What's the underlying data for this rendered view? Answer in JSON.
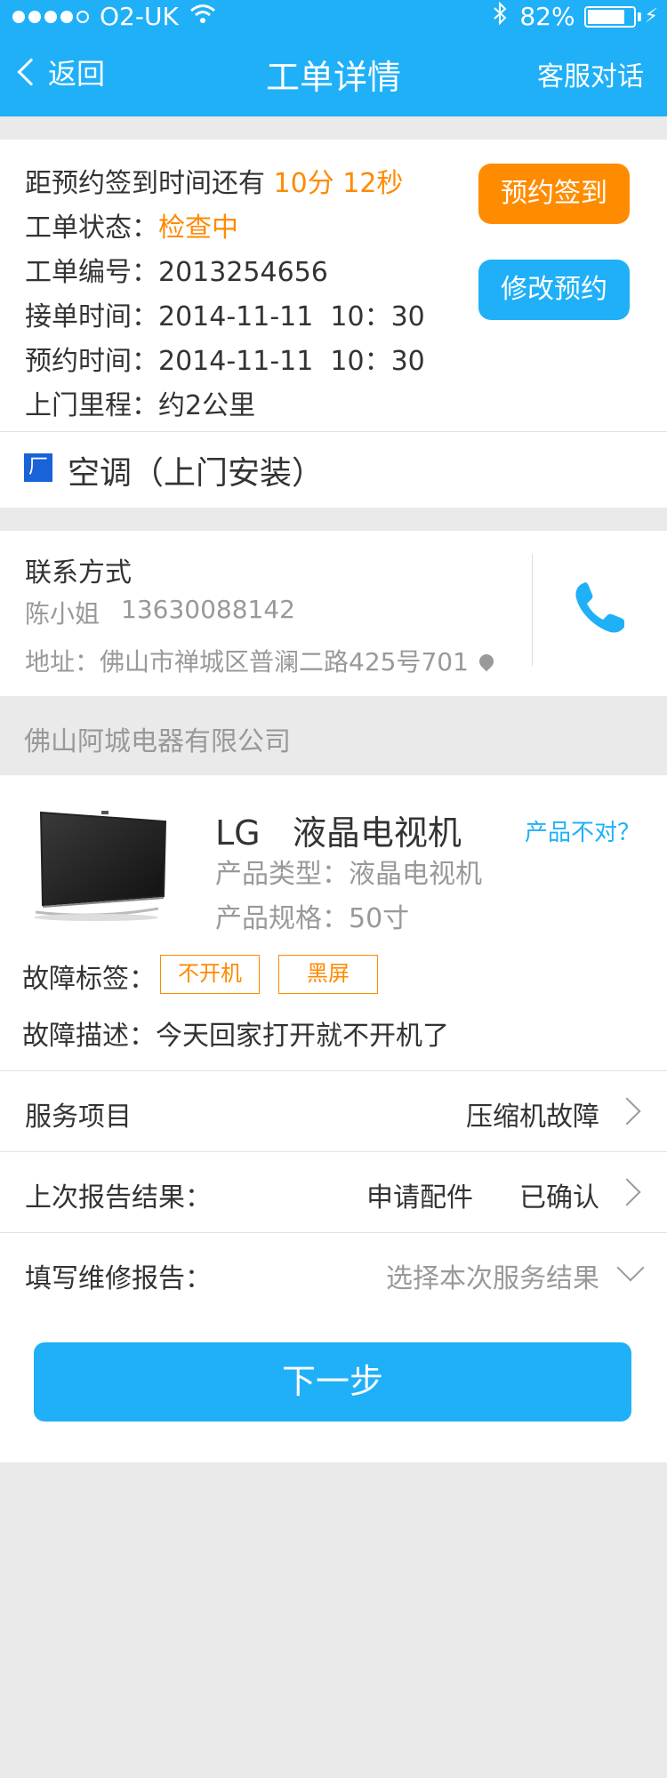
{
  "status_bar": {
    "carrier": "O2-UK",
    "battery_percent_text": "82%",
    "battery_level": 0.82
  },
  "nav": {
    "back_label": "返回",
    "title": "工单详情",
    "right_label": "客服对话"
  },
  "order": {
    "countdown_prefix": "距预约签到时间还有 ",
    "countdown_value": "10分 12秒",
    "status_label": "工单状态：",
    "status_value": "检查中",
    "number_label": "工单编号：",
    "number_value": "2013254656",
    "accept_label": "接单时间：",
    "accept_value": "2014-11-11  10：30",
    "appointment_label": "预约时间：",
    "appointment_value": "2014-11-11  10：30",
    "distance_label": "上门里程：",
    "distance_value": "约2公里",
    "checkin_button": "预约签到",
    "modify_button": "修改预约",
    "category_badge": "厂",
    "category_title": "空调（上门安装）"
  },
  "contact": {
    "label": "联系方式",
    "name": "陈小姐",
    "phone": "13630088142",
    "address": "地址：佛山市禅城区普澜二路425号701"
  },
  "company": {
    "name": "佛山阿城电器有限公司"
  },
  "product": {
    "name": "LG   液晶电视机",
    "wrong_link": "产品不对？",
    "type_label": "产品类型：",
    "type_value": "液晶电视机",
    "spec_label": "产品规格：",
    "spec_value": "50寸",
    "fault_tags_label": "故障标签：",
    "fault_tags": [
      "不开机",
      "黑屏"
    ],
    "fault_desc_label": "故障描述：",
    "fault_desc_value": "今天回家打开就不开机了"
  },
  "rows": {
    "service_label": "服务项目",
    "service_value": "压缩机故障",
    "last_report_label": "上次报告结果：",
    "last_report_value": "申请配件",
    "last_report_status": "已确认",
    "fill_report_label": "填写维修报告：",
    "fill_report_placeholder": "选择本次服务结果"
  },
  "next_button": "下一步",
  "colors": {
    "primary": "#1fb0f8",
    "accent_orange": "#ff8a00",
    "badge_blue": "#1962d8"
  },
  "icons": [
    "wifi-icon",
    "bluetooth-icon",
    "battery-icon",
    "back-chevron-icon",
    "location-pin-icon",
    "phone-icon",
    "tv-product-image",
    "chevron-right-icon",
    "chevron-down-icon"
  ]
}
